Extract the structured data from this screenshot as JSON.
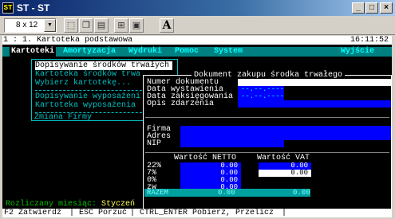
{
  "window": {
    "icon_text": "ST",
    "title": "ST - ST",
    "minimize": "_",
    "maximize": "□",
    "close": "×"
  },
  "toolbar": {
    "font_size": "8 x 12"
  },
  "header": {
    "path": "1 : 1. Kartoteka podstawowa",
    "clock": "16:11:52"
  },
  "menu": {
    "items": [
      "Kartoteki",
      "Amortyzacja",
      "Wydruki",
      "Pomoc",
      "System"
    ],
    "exit": "Wyjście"
  },
  "dropdown": {
    "items": [
      "Dopisywanie środków trwałych",
      "Kartoteka środków trwa",
      "Wybierz kartotekę...",
      "Dopisywanie wyposażeni",
      "Kartoteka wyposażenia",
      "Zmiana Firmy"
    ]
  },
  "dialog": {
    "title": "Dokument zakupu środka trwałego",
    "fields": {
      "numer": "Numer dokumentu",
      "data_wyst": "Data wystawienia",
      "data_ksieg": "Data zaksięgowania",
      "opis": "Opis zdarzenia",
      "date_placeholder": "--.--.----",
      "firma": "Firma",
      "adres": "Adres",
      "nip": "NIP"
    },
    "table": {
      "col_netto": "Wartość NETTO",
      "col_vat": "Wartość VAT",
      "rows": [
        {
          "label": "22%",
          "netto": "0.00",
          "vat": "0.00"
        },
        {
          "label": "7%",
          "netto": "0.00",
          "vat": "0.00"
        },
        {
          "label": "0%",
          "netto": "0.00",
          "vat": ""
        },
        {
          "label": "zw",
          "netto": "0.00",
          "vat": ""
        }
      ],
      "total_label": "RAZEM",
      "total_netto": "0.00",
      "total_vat": "0.00"
    }
  },
  "status": {
    "month_label": "Rozliczany miesiąc:",
    "month_value": "Styczeń"
  },
  "footer": {
    "f2": "F2 Zatwierdź",
    "esc": "ESC Porzuć",
    "ctrl": "CTRL_ENTER Pobierz, Przelicz"
  }
}
